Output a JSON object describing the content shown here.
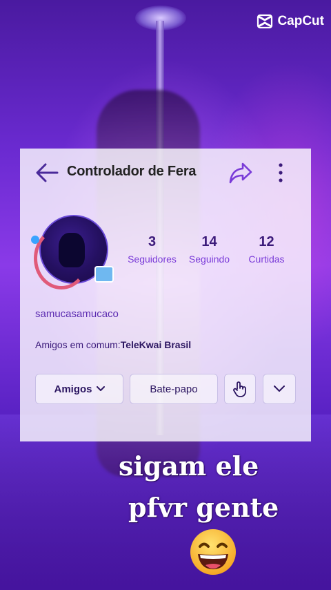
{
  "watermark": {
    "label": "CapCut",
    "icon": "capcut-logo-icon"
  },
  "profile": {
    "title": "Controlador de Fera",
    "username": "samucasamucaco",
    "mutual_label": "Amigos em comum:",
    "mutual_value": "TeleKwai Brasil",
    "stats": [
      {
        "value": "3",
        "label": "Seguidores"
      },
      {
        "value": "14",
        "label": "Seguindo"
      },
      {
        "value": "12",
        "label": "Curtidas"
      }
    ],
    "buttons": {
      "friends": "Amigos",
      "chat": "Bate-papo"
    }
  },
  "caption": {
    "line1": "sigam  ele",
    "line2": "pfvr  gente",
    "emoji": "grinning-face-emoji"
  },
  "colors": {
    "accent": "#7a3bd8",
    "text_dark": "#3b1a7a",
    "background": "#6a2ad0"
  }
}
